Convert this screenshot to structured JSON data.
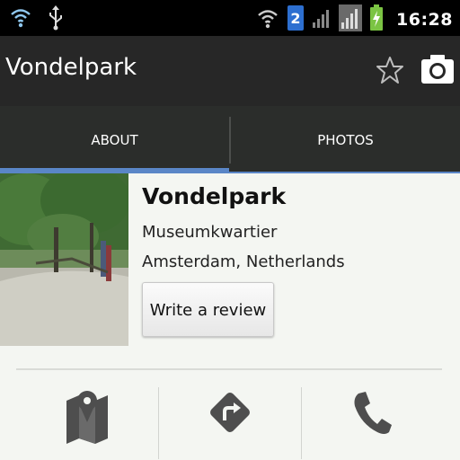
{
  "status_bar": {
    "time": "16:28",
    "icons": [
      "wifi-icon",
      "usb-icon",
      "wifi-signal-icon",
      "sim-2-icon",
      "cell-signal-icon",
      "cell-signal-full-icon",
      "battery-charging-icon"
    ],
    "sim_label": "2"
  },
  "action_bar": {
    "title": "Vondelpark",
    "icons": [
      "star-icon",
      "camera-icon"
    ]
  },
  "tabs": [
    {
      "label": "ABOUT",
      "selected": true
    },
    {
      "label": "PHOTOS",
      "selected": false
    }
  ],
  "place": {
    "name": "Vondelpark",
    "area": "Museumkwartier",
    "city": "Amsterdam, Netherlands",
    "review_button": "Write a review"
  },
  "actions": [
    "map-icon",
    "directions-icon",
    "phone-icon"
  ],
  "colors": {
    "tab_indicator": "#5a86c7",
    "action_bar": "#272727",
    "tab_bar": "#2b2d2b"
  }
}
